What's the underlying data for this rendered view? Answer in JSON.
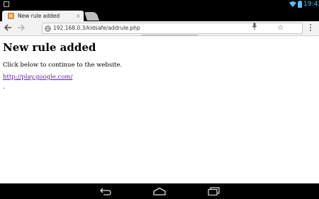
{
  "status_bar": {
    "time": "19:43",
    "icons": [
      "gallery-thumbnail-icon",
      "wifi-icon",
      "battery-icon"
    ],
    "accent_color": "#4fc3f7"
  },
  "browser": {
    "tab": {
      "title": "New rule added",
      "close_glyph": "×",
      "favicon": "kidsafe-favicon-icon"
    },
    "new_tab": "new-tab-icon",
    "toolbar": {
      "url": "192.168.0.3/kidsafe/addrule.php",
      "star_glyph": "☆",
      "icons": [
        "back-arrow-icon",
        "forward-arrow-icon",
        "globe-icon",
        "bookmark-star-icon",
        "microphone-icon",
        "overflow-menu-icon"
      ]
    }
  },
  "page": {
    "heading": "New rule added",
    "body_text": "Click below to continue to the website.",
    "link_text": "http://play.google.com/",
    "trailing_text": ".",
    "link_color": "#5b2ca0"
  },
  "nav_bar": {
    "icons": [
      "back-nav-icon",
      "home-nav-icon",
      "recent-apps-icon"
    ]
  }
}
